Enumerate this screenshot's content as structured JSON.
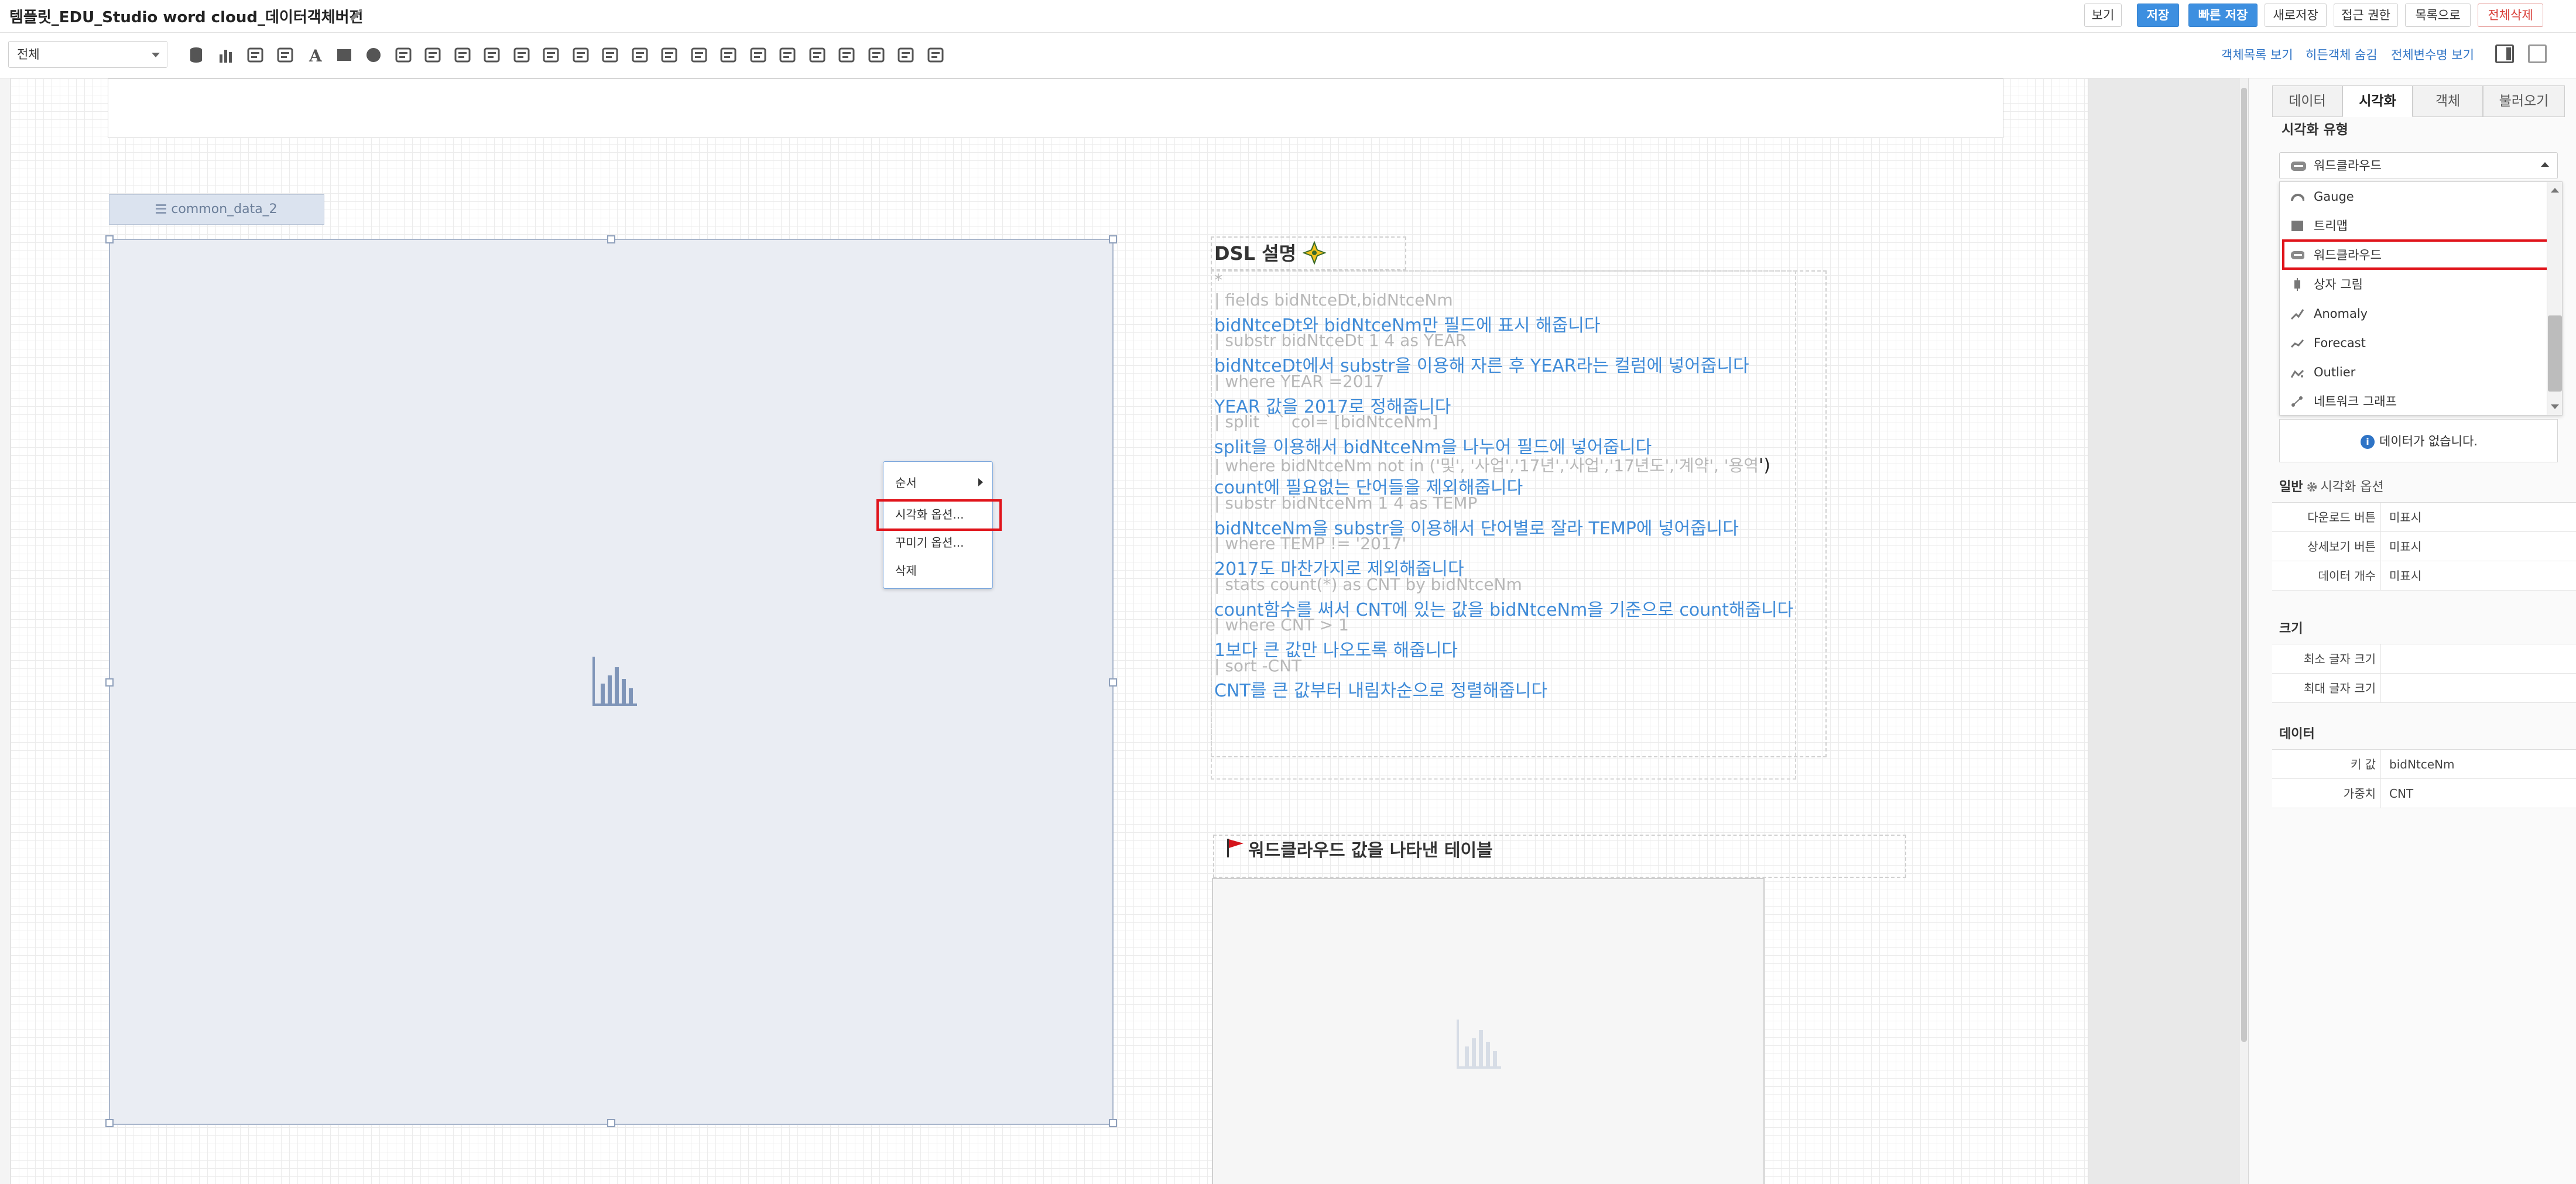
{
  "titlebar": {
    "title": "템플릿_EDU_Studio word cloud_데이터객체버전",
    "buttons": {
      "view": "보기",
      "save": "저장",
      "quick_save": "빠른 저장",
      "save_new": "새로저장",
      "access": "접근 권한",
      "list": "목록으로",
      "delete_all": "전체삭제"
    }
  },
  "toolbar": {
    "filter_value": "전체",
    "links": {
      "object_list": "객체목록 보기",
      "hidden": "히든객체 숨김",
      "global_vars": "전체변수명 보기"
    },
    "tool_icons": [
      "database-icon",
      "bar-chart-icon",
      "map-pin-icon",
      "map-icon",
      "text-icon",
      "rectangle-icon",
      "circle-icon",
      "image-icon",
      "input-icon",
      "textbox-icon",
      "button-icon",
      "checkbox-icon",
      "date-icon",
      "calendar-icon",
      "edit-icon",
      "photo-icon",
      "folder-icon",
      "list-icon",
      "tag-icon",
      "refresh-icon",
      "form-icon",
      "print-icon",
      "media-icon",
      "frame-icon",
      "move-icon",
      "export-icon"
    ]
  },
  "canvas": {
    "data_tag": "common_data_2",
    "context_menu": {
      "order": "순서",
      "vis_options": "시각화 옵션...",
      "deco_options": "꾸미기 옵션...",
      "delete": "삭제"
    },
    "dsl": {
      "title": "DSL 설명",
      "star": "*",
      "lines": [
        {
          "type": "cmd",
          "text": "| fields bidNtceDt,bidNtceNm"
        },
        {
          "type": "desc",
          "text": "bidNtceDt와 bidNtceNm만 필드에 표시 해줍니다"
        },
        {
          "type": "cmd",
          "text": "| substr bidNtceDt 1 4 as YEAR"
        },
        {
          "type": "desc",
          "text": "bidNtceDt에서 substr을 이용해 자른 후 YEAR라는 컬럼에 넣어줍니다"
        },
        {
          "type": "cmd",
          "text": "| where YEAR =2017"
        },
        {
          "type": "desc",
          "text": "YEAR 값을 2017로 정해줍니다"
        },
        {
          "type": "cmd",
          "text": "| split ` ` col= [bidNtceNm]"
        },
        {
          "type": "desc",
          "text": "split을 이용해서 bidNtceNm을 나누어 필드에 넣어줍니다"
        },
        {
          "type": "cmd",
          "text": "| where bidNtceNm not in ('및', '사업','17년','사업','17년도','계약', '용역"
        },
        {
          "type": "desc",
          "text": "count에 필요없는 단어들을 제외해줍니다"
        },
        {
          "type": "cmd",
          "text": "| substr bidNtceNm 1 4 as TEMP"
        },
        {
          "type": "desc",
          "text": "bidNtceNm을 substr을 이용해서 단어별로 잘라 TEMP에 넣어줍니다"
        },
        {
          "type": "cmd",
          "text": "| where TEMP != '2017'"
        },
        {
          "type": "desc",
          "text": "2017도 마찬가지로 제외해줍니다"
        },
        {
          "type": "cmd",
          "text": "| stats count(*) as CNT by bidNtceNm"
        },
        {
          "type": "desc",
          "text": "count함수를 써서 CNT에 있는 값을 bidNtceNm을 기준으로 count해줍니다"
        },
        {
          "type": "cmd",
          "text": "| where CNT > 1"
        },
        {
          "type": "desc",
          "text": "1보다 큰 값만 나오도록 해줍니다"
        },
        {
          "type": "cmd",
          "text": "| sort -CNT"
        },
        {
          "type": "desc",
          "text": "CNT를 큰 값부터 내림차순으로 정렬해줍니다"
        }
      ],
      "cut_suffix": "')"
    },
    "wordcloud_table_title": "워드클라우드 값을 나타낸 테이블"
  },
  "panel": {
    "tabs": [
      "데이터",
      "시각화",
      "객체",
      "불러오기"
    ],
    "active_tab": "시각화",
    "vis_type_label": "시각화 유형",
    "vis_type_selected": "워드클라우드",
    "dropdown_items": [
      {
        "label": "Gauge",
        "icon": "gauge-icon"
      },
      {
        "label": "트리맵",
        "icon": "treemap-icon"
      },
      {
        "label": "워드클라우드",
        "icon": "cloud-icon"
      },
      {
        "label": "상자 그림",
        "icon": "boxplot-icon"
      },
      {
        "label": "Anomaly",
        "icon": "anomaly-icon"
      },
      {
        "label": "Forecast",
        "icon": "forecast-icon"
      },
      {
        "label": "Outlier",
        "icon": "outlier-icon"
      },
      {
        "label": "네트워크 그래프",
        "icon": "network-icon"
      }
    ],
    "no_data": "데이터가 없습니다.",
    "general_label": "일반",
    "vis_options_label": "시각화 옵션",
    "general_rows": [
      {
        "key": "다운로드 버튼",
        "value": "미표시"
      },
      {
        "key": "상세보기 버튼",
        "value": "미표시"
      },
      {
        "key": "데이터 개수",
        "value": "미표시"
      }
    ],
    "size_label": "크기",
    "size_rows": [
      {
        "key": "최소 글자 크기",
        "value": ""
      },
      {
        "key": "최대 글자 크기",
        "value": ""
      }
    ],
    "data_label": "데이터",
    "data_rows": [
      {
        "key": "키 값",
        "value": "bidNtceNm"
      },
      {
        "key": "가중치",
        "value": "CNT"
      }
    ]
  },
  "colors": {
    "accent_blue": "#3d8fe0",
    "link_blue": "#2f74c6",
    "highlight_red": "#e0141b",
    "desc_blue": "#3f8bd8",
    "cmd_gray": "#b8b8b8"
  }
}
